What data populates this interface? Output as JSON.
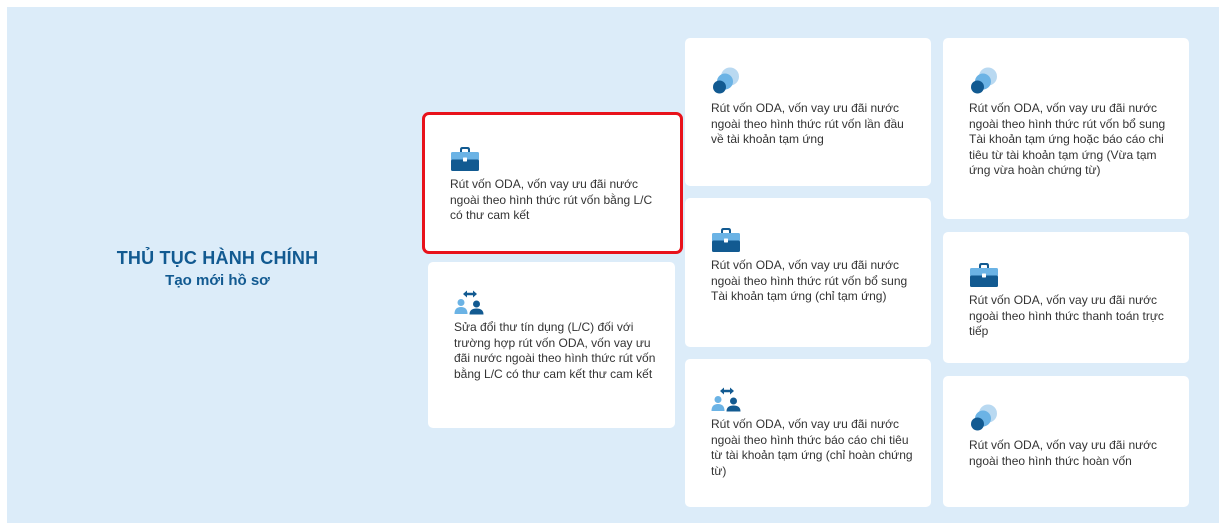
{
  "heading": {
    "title": "THỦ TỤC HÀNH CHÍNH",
    "subtitle": "Tạo mới hồ sơ"
  },
  "cards": [
    {
      "label": "Rút vốn ODA, vốn vay ưu đãi nước ngoài theo hình thức rút vốn bằng L/C có thư cam kết",
      "icon": "briefcase-icon",
      "selected": true
    },
    {
      "label": "Sửa đổi thư tín dụng (L/C) đối với trường hợp rút vốn ODA, vốn vay ưu đãi nước ngoài theo hình thức rút vốn bằng L/C có thư cam kết thư cam kết",
      "icon": "exchange-people-icon"
    },
    {
      "label": "Rút vốn ODA, vốn vay ưu đãi nước ngoài theo hình thức rút vốn lần đầu về tài khoản tạm ứng",
      "icon": "circles-icon"
    },
    {
      "label": "Rút vốn ODA, vốn vay ưu đãi nước ngoài theo hình thức rút vốn bổ sung Tài khoản tạm ứng (chỉ tạm ứng)",
      "icon": "briefcase-icon"
    },
    {
      "label": "Rút vốn ODA, vốn vay ưu đãi nước ngoài theo hình thức báo cáo chi tiêu từ tài khoản tạm ứng (chỉ hoàn chứng từ)",
      "icon": "exchange-people-icon"
    },
    {
      "label": "Rút vốn ODA, vốn vay ưu đãi nước ngoài theo hình thức rút vốn bổ sung Tài khoản tạm ứng hoặc báo cáo chi tiêu từ tài khoản tạm ứng (Vừa tạm ứng vừa hoàn chứng từ)",
      "icon": "circles-icon"
    },
    {
      "label": "Rút vốn ODA, vốn vay ưu đãi nước ngoài theo hình thức thanh toán trực tiếp",
      "icon": "briefcase-icon"
    },
    {
      "label": "Rút vốn ODA, vốn vay ưu đãi nước ngoài theo hình thức hoàn vốn",
      "icon": "circles-icon"
    }
  ],
  "colors": {
    "primary": "#125a91",
    "icon_light": "#b9d9f1",
    "icon_mid": "#6bb3e5",
    "selected_border": "#e8121b",
    "background": "#dcecf9"
  }
}
